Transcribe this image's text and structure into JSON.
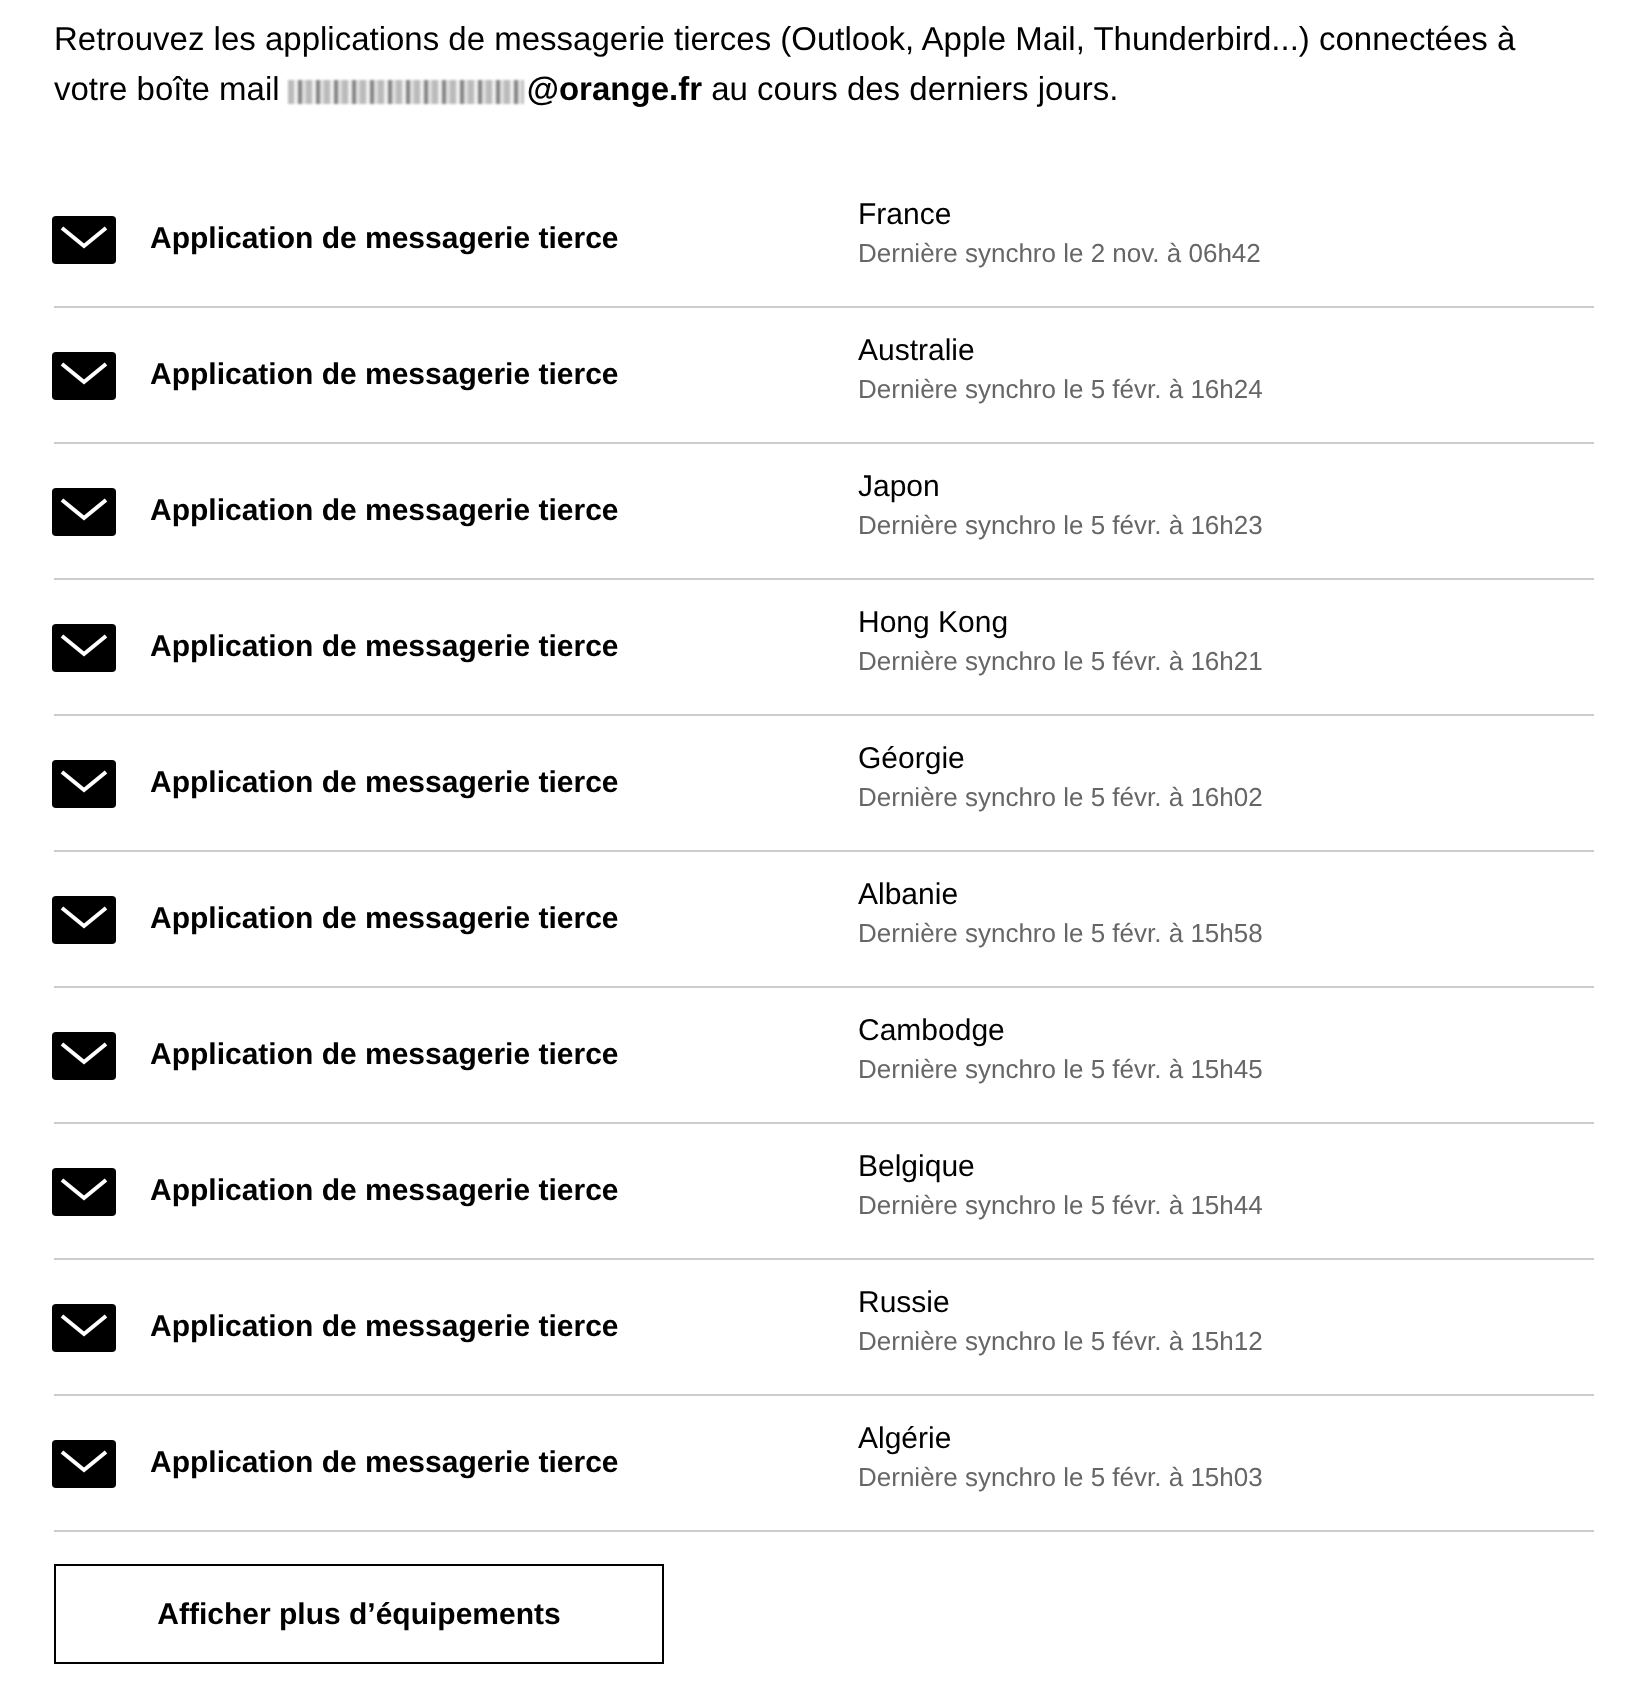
{
  "intro": {
    "before": "Retrouvez les applications de messagerie tierces (Outlook, Apple Mail, Thunderbird...) connectées à votre boîte mail",
    "after": "**@orange.fr** au cours des derniers jours."
  },
  "devices": [
    {
      "name": "Application de messagerie tierce",
      "country": "France",
      "sync": "Dernière synchro le 2 nov. à 06h42"
    },
    {
      "name": "Application de messagerie tierce",
      "country": "Australie",
      "sync": "Dernière synchro le 5 févr. à 16h24"
    },
    {
      "name": "Application de messagerie tierce",
      "country": "Japon",
      "sync": "Dernière synchro le 5 févr. à 16h23"
    },
    {
      "name": "Application de messagerie tierce",
      "country": "Hong Kong",
      "sync": "Dernière synchro le 5 févr. à 16h21"
    },
    {
      "name": "Application de messagerie tierce",
      "country": "Géorgie",
      "sync": "Dernière synchro le 5 févr. à 16h02"
    },
    {
      "name": "Application de messagerie tierce",
      "country": "Albanie",
      "sync": "Dernière synchro le 5 févr. à 15h58"
    },
    {
      "name": "Application de messagerie tierce",
      "country": "Cambodge",
      "sync": "Dernière synchro le 5 févr. à 15h45"
    },
    {
      "name": "Application de messagerie tierce",
      "country": "Belgique",
      "sync": "Dernière synchro le 5 févr. à 15h44"
    },
    {
      "name": "Application de messagerie tierce",
      "country": "Russie",
      "sync": "Dernière synchro le 5 févr. à 15h12"
    },
    {
      "name": "Application de messagerie tierce",
      "country": "Algérie",
      "sync": "Dernière synchro le 5 févr. à 15h03"
    }
  ],
  "more_button": "Afficher plus d’équipements"
}
